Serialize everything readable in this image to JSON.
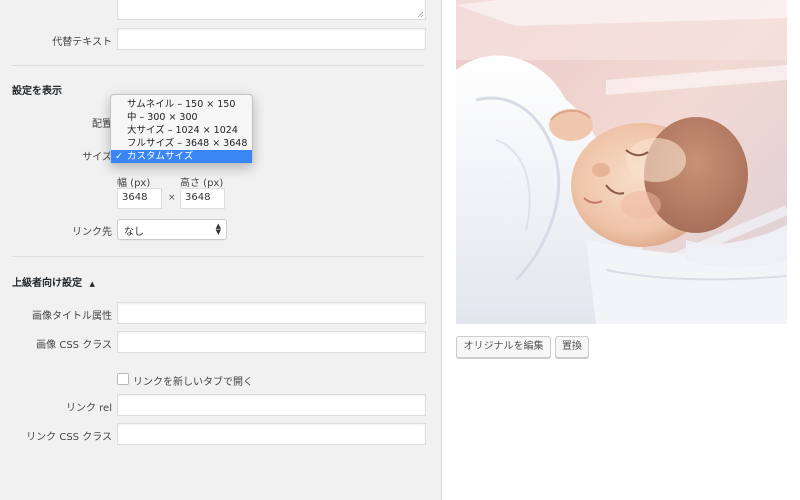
{
  "form": {
    "alt_text_label": "代替テキスト",
    "display_settings_heading": "設定を表示",
    "alignment_label": "配置",
    "size_label": "サイズ",
    "size_options": [
      "サムネイル – 150 × 150",
      "中 – 300 × 300",
      "大サイズ – 1024 × 1024",
      "フルサイズ – 3648 × 3648",
      "カスタムサイズ"
    ],
    "size_selected_index": 4,
    "check_mark": "✓",
    "width_label": "幅 (px)",
    "height_label": "高さ (px)",
    "width_value": "3648",
    "height_value": "3648",
    "times_sign": "×",
    "link_to_label": "リンク先",
    "link_to_value": "なし",
    "advanced_heading": "上級者向け設定",
    "advanced_toggle": "▲",
    "image_title_label": "画像タイトル属性",
    "image_css_label": "画像 CSS クラス",
    "open_new_tab_label": "リンクを新しいタブで開く",
    "link_rel_label": "リンク rel",
    "link_css_label": "リンク CSS クラス"
  },
  "preview": {
    "edit_original_button": "オリジナルを編集",
    "replace_button": "置換"
  }
}
